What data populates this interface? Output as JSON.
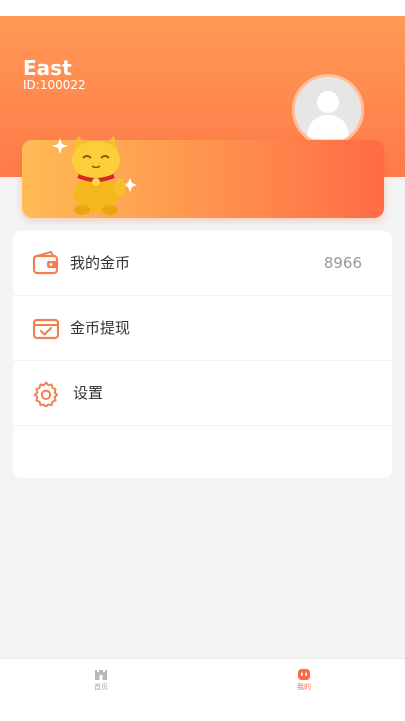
{
  "user": {
    "name": "East",
    "id_text": "ID:100022"
  },
  "icons": {
    "avatar": "default-user-icon",
    "banner": "lucky-cat-icon",
    "coins": "wallet-icon",
    "withdraw": "card-check-icon",
    "settings": "gear-icon",
    "home_tab": "castle-icon",
    "mine_tab": "robot-face-icon"
  },
  "menu": {
    "items": [
      {
        "label": "我的金币",
        "value": "8966"
      },
      {
        "label": "金币提现",
        "value": ""
      },
      {
        "label": "设置",
        "value": ""
      }
    ]
  },
  "tabbar": {
    "home_label": "首页",
    "mine_label": "我的"
  },
  "colors": {
    "accent": "#ff7a4a",
    "icon_orange": "#f0804f",
    "active_tab": "#ff6b45",
    "inactive_tab": "#aaaaaa"
  }
}
